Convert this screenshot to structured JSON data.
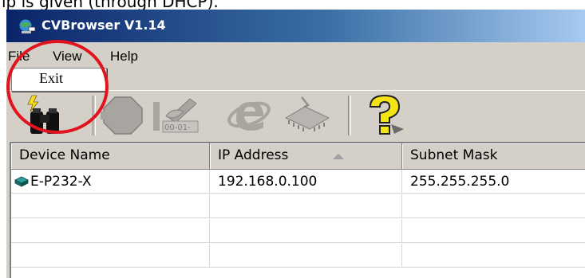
{
  "caption": {
    "text": "ip is given (through DHCP)."
  },
  "window": {
    "title": "CVBrowser V1.14"
  },
  "menu": {
    "items": [
      {
        "label": "File"
      },
      {
        "label": "View"
      },
      {
        "label": "Help"
      }
    ],
    "open_dropdown": {
      "items": [
        {
          "label": "Exit"
        }
      ]
    }
  },
  "toolbar": {
    "buttons": [
      {
        "icon": "binoculars-search-icon",
        "enabled": true
      },
      {
        "icon": "stop-sign-icon",
        "enabled": false
      },
      {
        "icon": "edit-address-icon",
        "enabled": false,
        "label": "00-01-"
      },
      {
        "icon": "internet-explorer-icon",
        "enabled": false
      },
      {
        "icon": "chip-firmware-icon",
        "enabled": false
      },
      {
        "icon": "help-question-icon",
        "enabled": true
      }
    ]
  },
  "table": {
    "columns": [
      {
        "label": "Device Name"
      },
      {
        "label": "IP Address",
        "sort": "ascending"
      },
      {
        "label": "Subnet Mask"
      }
    ],
    "rows": [
      {
        "device_name": "E-P232-X",
        "ip": "192.168.0.100",
        "subnet": "255.255.255.0"
      }
    ]
  },
  "colors": {
    "annotation": "#e0141e",
    "titlebar_start": "#0a246a",
    "titlebar_end": "#a6caf0"
  }
}
